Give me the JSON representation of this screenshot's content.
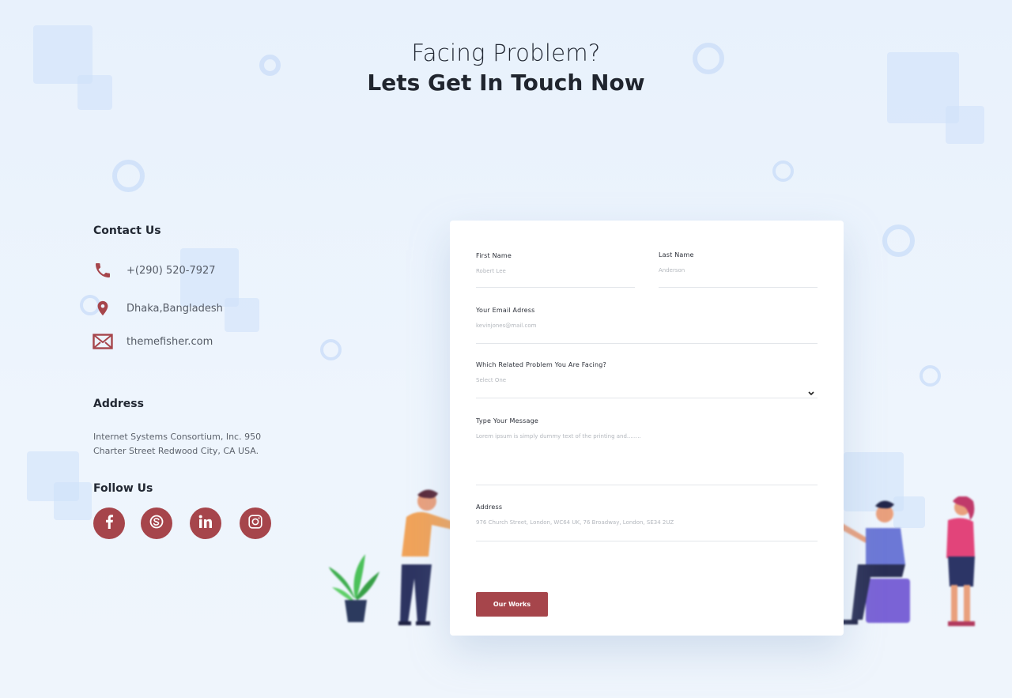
{
  "heading": {
    "line1": "Facing Problem?",
    "line2": "Lets Get In Touch Now"
  },
  "contact": {
    "title": "Contact Us",
    "phone": "+(290) 520-7927",
    "location": "Dhaka,Bangladesh",
    "website": "themefisher.com"
  },
  "address": {
    "title": "Address",
    "text": "Internet Systems Consortium, Inc. 950 Charter Street Redwood City, CA USA."
  },
  "follow": {
    "title": "Follow Us",
    "icons": [
      "facebook-icon",
      "skype-icon",
      "linkedin-icon",
      "instagram-icon"
    ]
  },
  "form": {
    "first_name": {
      "label": "First Name",
      "placeholder": "Robert Lee"
    },
    "last_name": {
      "label": "Last Name",
      "placeholder": "Anderson"
    },
    "email": {
      "label": "Your Email Adress",
      "placeholder": "kevinjones@mail.com"
    },
    "problem": {
      "label": "Which Related Problem You Are Facing?",
      "selected": "Select One"
    },
    "message": {
      "label": "Type Your Message",
      "placeholder": "Lorem ipsum is simply dummy text of the printing and........"
    },
    "address": {
      "label": "Address",
      "placeholder": "976 Church Street, London, WC64 UK, 76 Broadway, London, SE34 2UZ"
    },
    "submit_label": "Our Works"
  },
  "colors": {
    "accent": "#a6454b",
    "background": "#eaf2fc",
    "heading": "#20252e"
  }
}
